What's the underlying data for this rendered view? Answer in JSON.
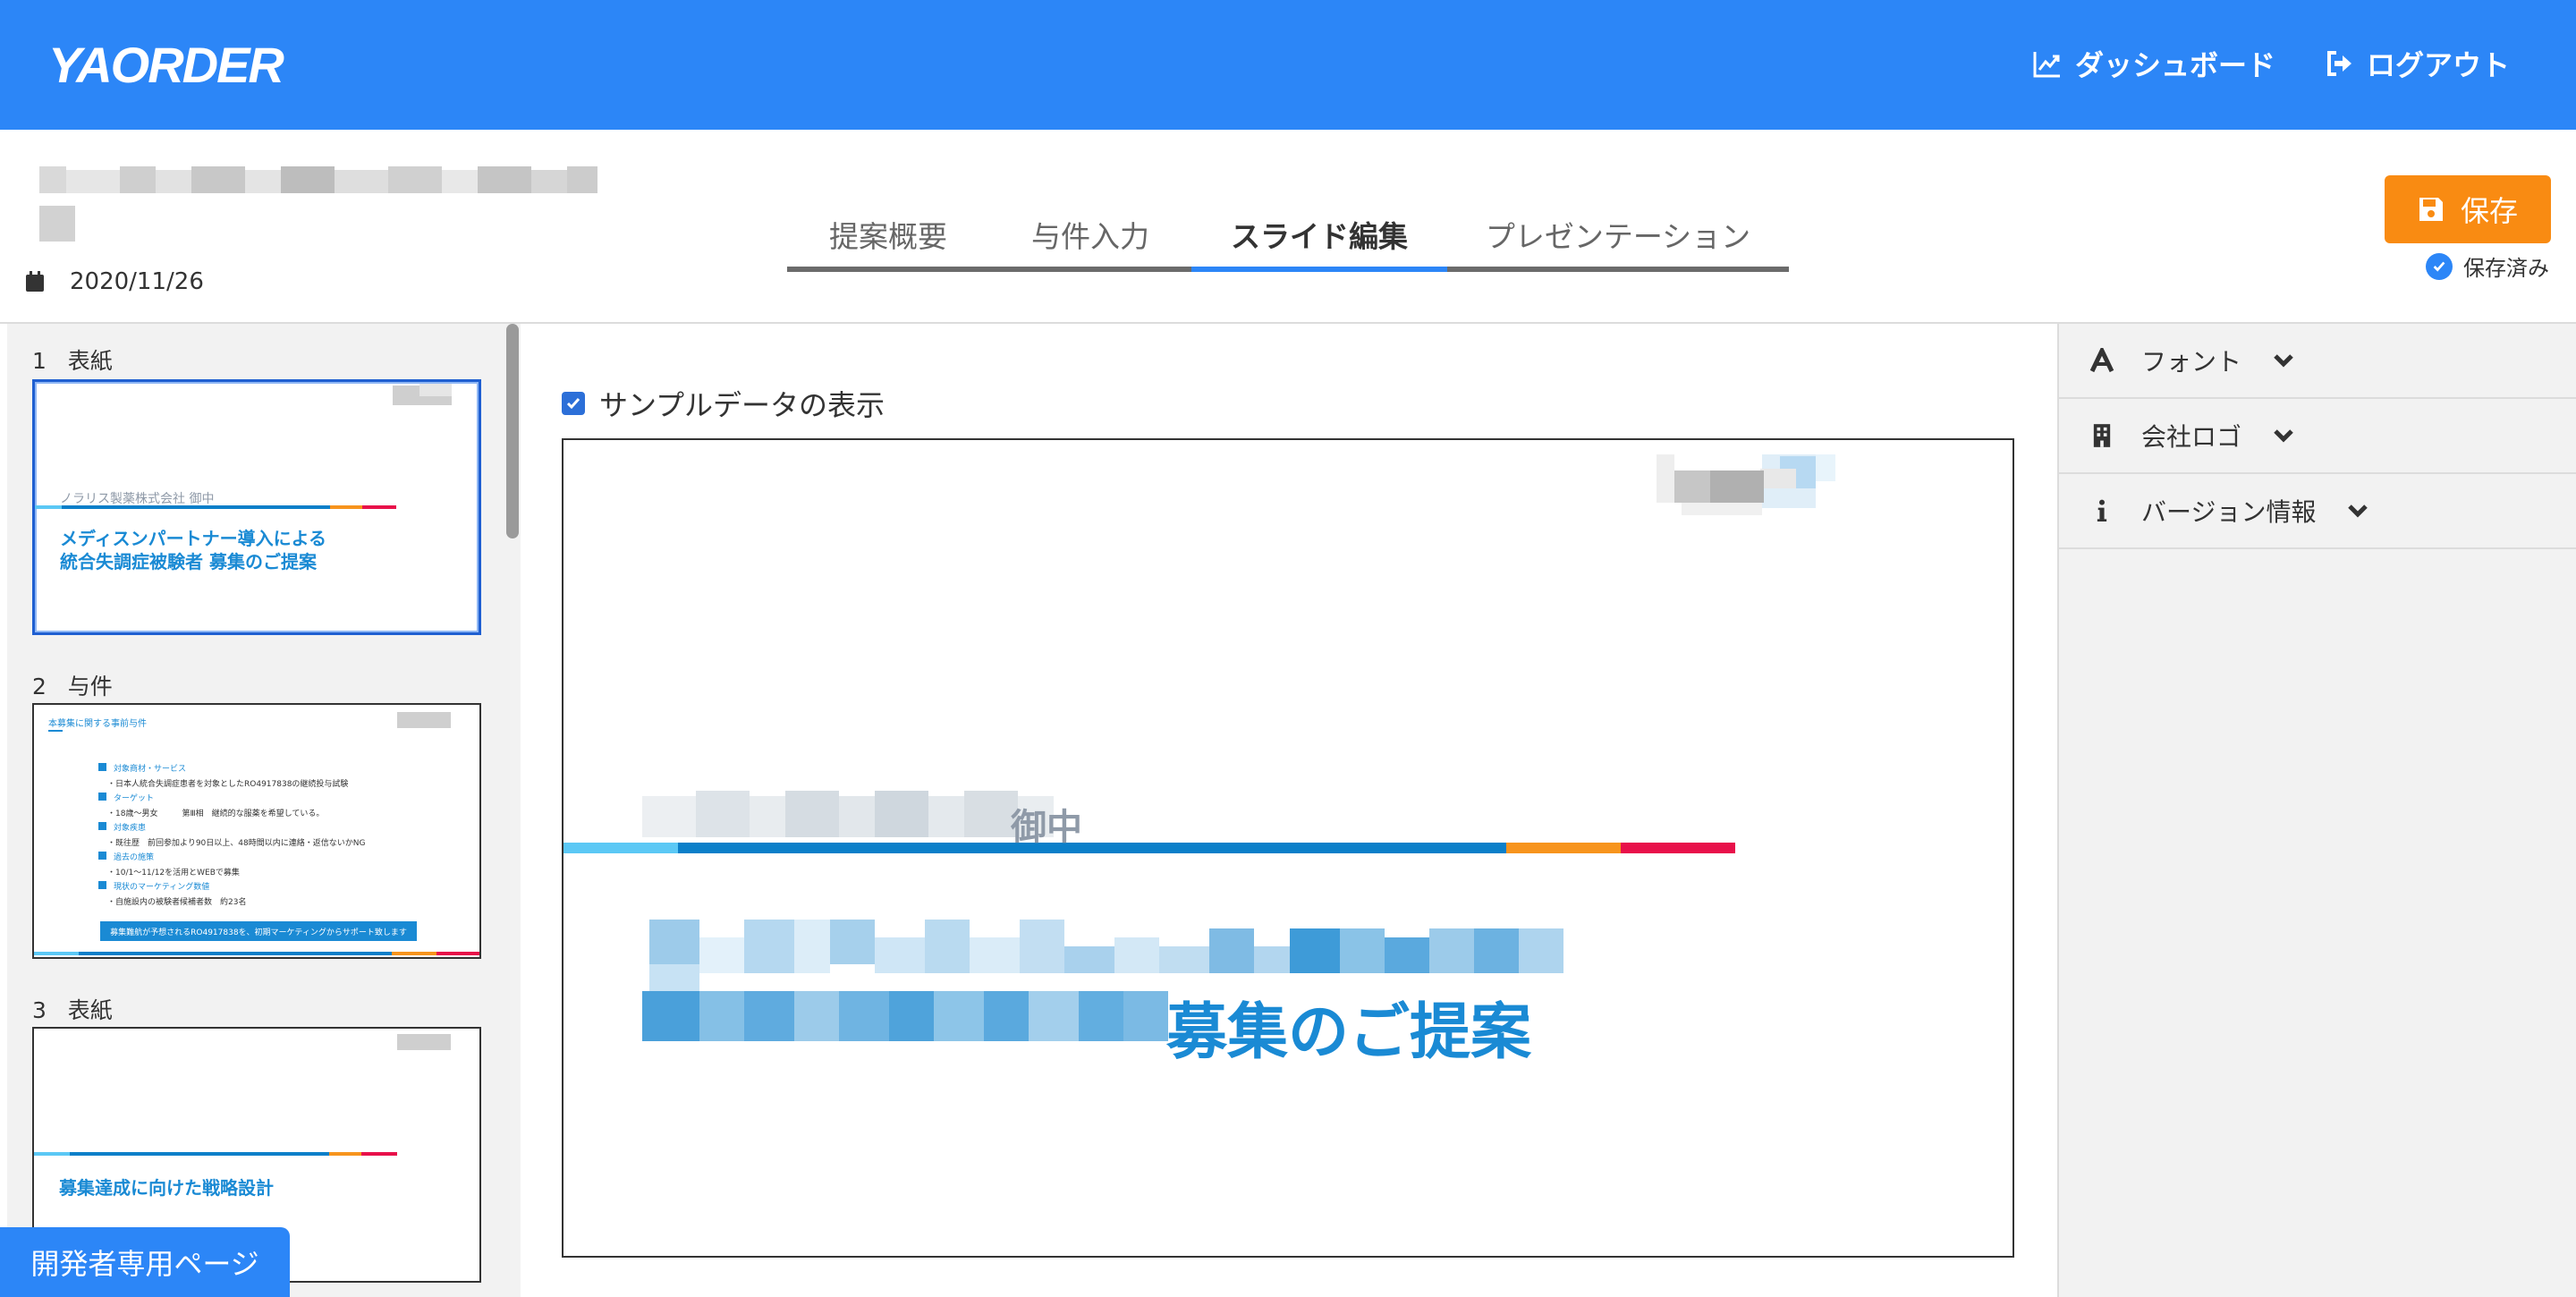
{
  "header": {
    "logo": "YAORDER",
    "dashboard_label": "ダッシュボード",
    "logout_label": "ログアウト"
  },
  "doc": {
    "date": "2020/11/26"
  },
  "tabs": [
    {
      "label": "提案概要"
    },
    {
      "label": "与件入力"
    },
    {
      "label": "スライド編集"
    },
    {
      "label": "プレゼンテーション"
    }
  ],
  "save": {
    "label": "保存",
    "status": "保存済み"
  },
  "slides": [
    {
      "number": "1",
      "name": "表紙",
      "client": "ノラリス製薬株式会社 御中",
      "title_line1": "メディスンパートナー導入による",
      "title_line2": "統合失調症被験者 募集のご提案"
    },
    {
      "number": "2",
      "name": "与件",
      "heading": "本募集に関する事前与件",
      "items": [
        {
          "head": "対象商材・サービス",
          "body": "・日本人統合失調症患者を対象としたRO4917838の継続投与試験"
        },
        {
          "head": "ターゲット",
          "body": "・18歳～男女　　　第Ⅲ相　継続的な服薬を希望している。"
        },
        {
          "head": "対象疾患",
          "body": "・既往歴　前回参加より90日以上、48時間以内に連絡・返信ないかNG"
        },
        {
          "head": "過去の施策",
          "body": "・10/1～11/12を活用とWEBで募集"
        },
        {
          "head": "現状のマーケティング数値",
          "body": "・自施設内の被験者候補者数　約23名"
        }
      ],
      "banner": "募集難航が予想されるRO4917838を、初期マーケティングからサポート致します"
    },
    {
      "number": "3",
      "name": "表紙",
      "title": "募集達成に向けた戦略設計"
    }
  ],
  "canvas": {
    "sample_label": "サンプルデータの表示",
    "client_suffix": "御中",
    "title_suffix": "募集のご提案"
  },
  "right_panel": [
    {
      "label": "フォント",
      "icon": "font-icon"
    },
    {
      "label": "会社ロゴ",
      "icon": "building-icon"
    },
    {
      "label": "バージョン情報",
      "icon": "info-icon"
    }
  ],
  "dev_button": "開発者専用ページ",
  "colors": {
    "primary": "#2c86f7",
    "save": "#f98b12",
    "slide_blue": "#1a8ad4",
    "stripe_light": "#5bc8f5",
    "stripe_blue": "#0a7fc9",
    "stripe_orange": "#f7941d",
    "stripe_red": "#e8104a"
  }
}
